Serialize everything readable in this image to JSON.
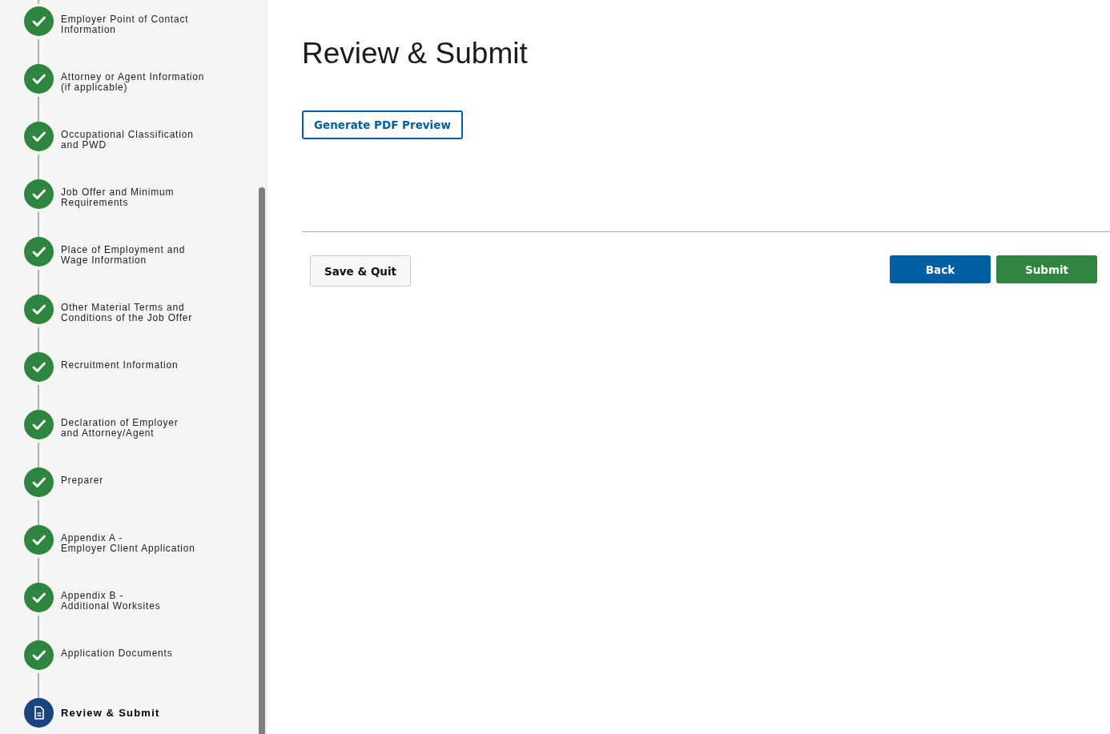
{
  "steps": [
    {
      "lines": [
        "Employer Point of Contact",
        "Information"
      ],
      "kind": "complete"
    },
    {
      "lines": [
        "Attorney or Agent Information",
        "(if applicable)"
      ],
      "kind": "complete"
    },
    {
      "lines": [
        "Occupational Classification",
        "and PWD"
      ],
      "kind": "complete"
    },
    {
      "lines": [
        "Job Offer and Minimum",
        "Requirements"
      ],
      "kind": "complete"
    },
    {
      "lines": [
        "Place of Employment and",
        "Wage Information"
      ],
      "kind": "complete"
    },
    {
      "lines": [
        "Other Material Terms and",
        "Conditions of the Job Offer"
      ],
      "kind": "complete"
    },
    {
      "lines": [
        "Recruitment Information"
      ],
      "kind": "complete"
    },
    {
      "lines": [
        "Declaration of Employer",
        "and Attorney/Agent"
      ],
      "kind": "complete"
    },
    {
      "lines": [
        "Preparer"
      ],
      "kind": "complete"
    },
    {
      "lines": [
        "Appendix A -",
        "Employer Client Application"
      ],
      "kind": "complete"
    },
    {
      "lines": [
        "Appendix B -",
        "Additional Worksites"
      ],
      "kind": "complete"
    },
    {
      "lines": [
        "Application Documents"
      ],
      "kind": "complete"
    },
    {
      "lines": [
        "Review & Submit"
      ],
      "kind": "current"
    }
  ],
  "page_title": "Review & Submit",
  "preview_button": "Generate PDF Preview",
  "actions": {
    "save_quit": "Save & Quit",
    "back": "Back",
    "submit": "Submit"
  }
}
